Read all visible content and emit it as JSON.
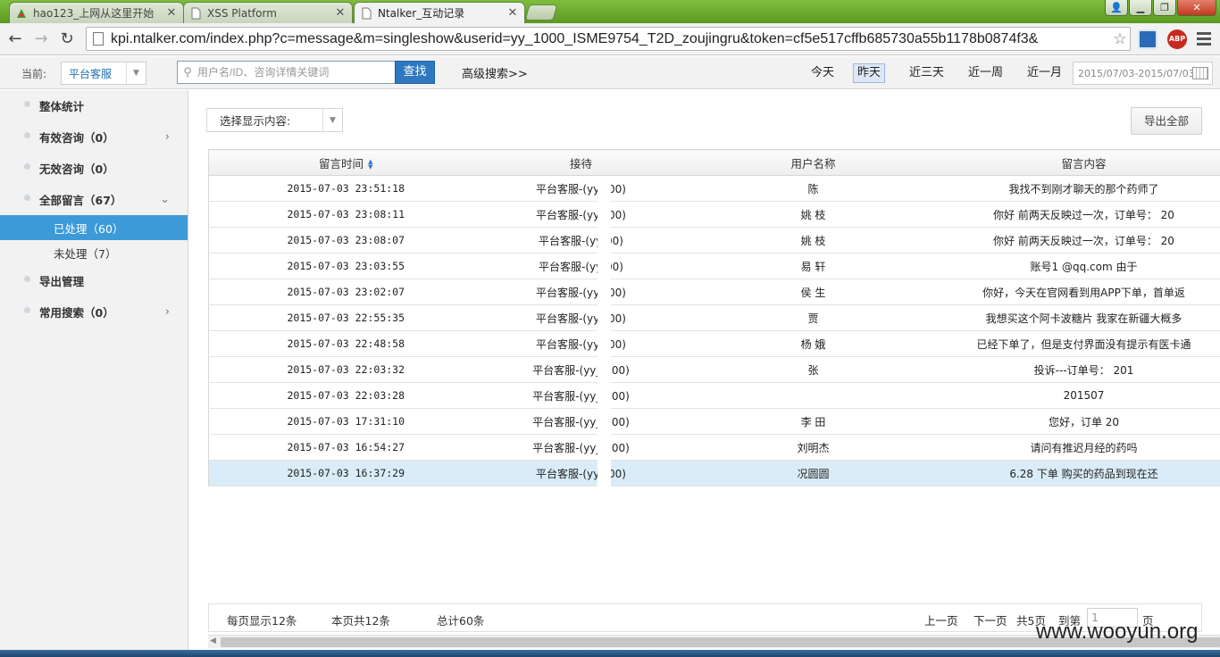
{
  "browser": {
    "tabs": [
      {
        "label": "hao123_上网从这里开始",
        "icon": "hao123-icon"
      },
      {
        "label": "XSS Platform",
        "icon": "page-icon"
      },
      {
        "label": "Ntalker_互动记录",
        "icon": "page-icon"
      }
    ],
    "url": "kpi.ntalker.com/index.php?c=message&m=singleshow&userid=yy_1000_ISME9754_T2D_zoujingru&token=cf5e517cffb685730a55b1178b0874f3&",
    "abp_label": "ABP"
  },
  "header": {
    "current_label": "当前:",
    "current_value": "平台客服",
    "search_placeholder": "用户名/ID、咨询详情关键词",
    "search_button": "查找",
    "advanced_search": "高级搜索>>",
    "quick_ranges": [
      "今天",
      "昨天",
      "近三天",
      "近一周",
      "近一月"
    ],
    "selected_range": "昨天",
    "date_range": "2015/07/03-2015/07/03"
  },
  "sidebar": {
    "items": [
      {
        "label": "整体统计",
        "chevron": ""
      },
      {
        "label": "有效咨询（0）",
        "chevron": "›"
      },
      {
        "label": "无效咨询（0）",
        "chevron": ""
      },
      {
        "label": "全部留言（67）",
        "chevron": "⌄"
      }
    ],
    "subitems": [
      {
        "label": "已处理（60）",
        "selected": true
      },
      {
        "label": "未处理（7）",
        "selected": false
      }
    ],
    "items_after": [
      {
        "label": "导出管理",
        "chevron": ""
      },
      {
        "label": "常用搜索（0）",
        "chevron": "›"
      }
    ]
  },
  "main": {
    "filter_label": "选择显示内容:",
    "export_button": "导出全部",
    "columns": [
      "留言时间",
      "接待",
      "用户名称",
      "留言内容"
    ],
    "rows": [
      {
        "time": "2015-07-03 23:51:18",
        "agent": "平台客服-(yy_  00)",
        "user": "陈 ",
        "content": "我找不到刚才聊天的那个药师了"
      },
      {
        "time": "2015-07-03 23:08:11",
        "agent": "平台客服-(yy_  00)",
        "user": "姚  枝",
        "content": "你好 前两天反映过一次，订单号： 20"
      },
      {
        "time": "2015-07-03 23:08:07",
        "agent": "平台客服-(yy  00)",
        "user": "姚  枝",
        "content": "你好 前两天反映过一次，订单号： 20"
      },
      {
        "time": "2015-07-03 23:03:55",
        "agent": "平台客服-(yy  00)",
        "user": "易  轩",
        "content": "账号1   @qq.com 由于"
      },
      {
        "time": "2015-07-03 23:02:07",
        "agent": "平台客服-(yy_  00)",
        "user": "侯  生",
        "content": "你好，今天在官网看到用APP下单，首单返"
      },
      {
        "time": "2015-07-03 22:55:35",
        "agent": "平台客服-(yy_  00)",
        "user": "贾 ",
        "content": "我想买这个阿卡波糖片 我家在新疆大概多"
      },
      {
        "time": "2015-07-03 22:48:58",
        "agent": "平台客服-(yy_  00)",
        "user": "杨  娥",
        "content": "已经下单了，但是支付界面没有提示有医卡通"
      },
      {
        "time": "2015-07-03 22:03:32",
        "agent": "平台客服-(yy_  000)",
        "user": "张  ",
        "content": "投诉---订单号： 201    "
      },
      {
        "time": "2015-07-03 22:03:28",
        "agent": "平台客服-(yy_  000)",
        "user": "",
        "content": "201507      "
      },
      {
        "time": "2015-07-03 17:31:10",
        "agent": "平台客服-(yy_  000)",
        "user": "李  田",
        "content": "您好，订单 20     "
      },
      {
        "time": "2015-07-03 16:54:27",
        "agent": "平台客服-(yy_  000)",
        "user": "刘明杰",
        "content": "请问有推迟月经的药吗"
      },
      {
        "time": "2015-07-03 16:37:29",
        "agent": "平台客服-(yy_  00)",
        "user": "况圆圆",
        "content": "6.28 下单 购买的药品到现在还"
      }
    ],
    "selected_row": 11
  },
  "pager": {
    "per_page": "每页显示12条",
    "this_page": "本页共12条",
    "total": "总计60条",
    "prev": "上一页",
    "next": "下一页",
    "pages": "共5页",
    "goto": "到第",
    "goto_value": "1",
    "page_unit": "页"
  },
  "watermark": "www.wooyun.org"
}
